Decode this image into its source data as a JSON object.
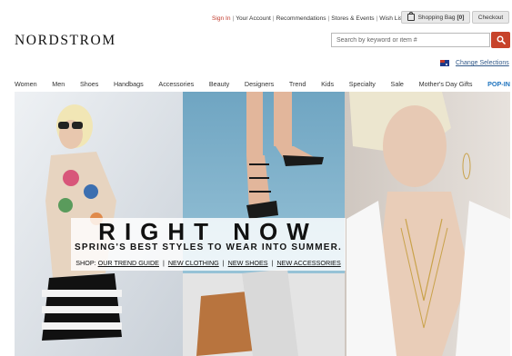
{
  "utility": {
    "sign_in": "Sign In",
    "your_account": "Your Account",
    "recommendations": "Recommendations",
    "stores_events": "Stores & Events",
    "wish_list": "Wish List",
    "separator": "|"
  },
  "header": {
    "logo": "NORDSTROM",
    "shopping_bag_label": "Shopping Bag",
    "shopping_bag_count": "[0]",
    "checkout_label": "Checkout",
    "search_placeholder": "Search by keyword or item #",
    "change_selections": "Change Selections",
    "country_flag_icon": "australia-flag-icon"
  },
  "nav": {
    "items": [
      "Women",
      "Men",
      "Shoes",
      "Handbags",
      "Accessories",
      "Beauty",
      "Designers",
      "Trend",
      "Kids",
      "Specialty",
      "Sale",
      "Mother's Day Gifts",
      "POP-IN"
    ],
    "active": "POP-IN"
  },
  "hero": {
    "headline": "RIGHT NOW",
    "subheadline": "SPRING'S BEST STYLES TO WEAR INTO SUMMER.",
    "shop_prefix": "SHOP:",
    "links": [
      "OUR TREND GUIDE",
      "NEW CLOTHING",
      "NEW SHOES",
      "NEW ACCESSORIES"
    ]
  },
  "colors": {
    "accent_red": "#c7432a",
    "link_blue": "#1e73be",
    "change_link": "#335a8a"
  }
}
